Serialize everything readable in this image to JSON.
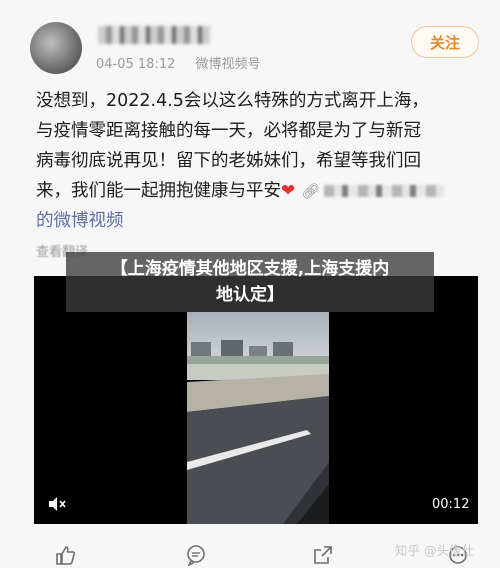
{
  "post": {
    "date": "04-05 18:12",
    "source": "微博视频号",
    "follow_label": "关注",
    "body_lines": [
      "没想到，2022.4.5会以这么特殊的方式离开上海，",
      "与疫情零距离接触的每一天，必将都是为了与新冠",
      "病毒彻底说再见！留下的老姊妹们，希望等我们回",
      "来，我们能一起拥抱健康与平安"
    ],
    "video_link": "的微博视频",
    "view_translation": "查看翻译"
  },
  "overlay": {
    "title_line1": "【上海疫情其他地区支援,上海支援内",
    "title_line2": "地认定】"
  },
  "video": {
    "duration": "00:12"
  },
  "watermark": "知乎 @头像仕",
  "icons": {
    "heart": "heart-icon",
    "link": "link-icon",
    "mute": "mute-icon",
    "like": "thumbs-up-icon",
    "comment": "comment-icon",
    "share": "share-icon"
  },
  "colors": {
    "follow_accent": "#e38a2a",
    "link_blue": "#5b6fa6",
    "heart_red": "#e43434"
  }
}
